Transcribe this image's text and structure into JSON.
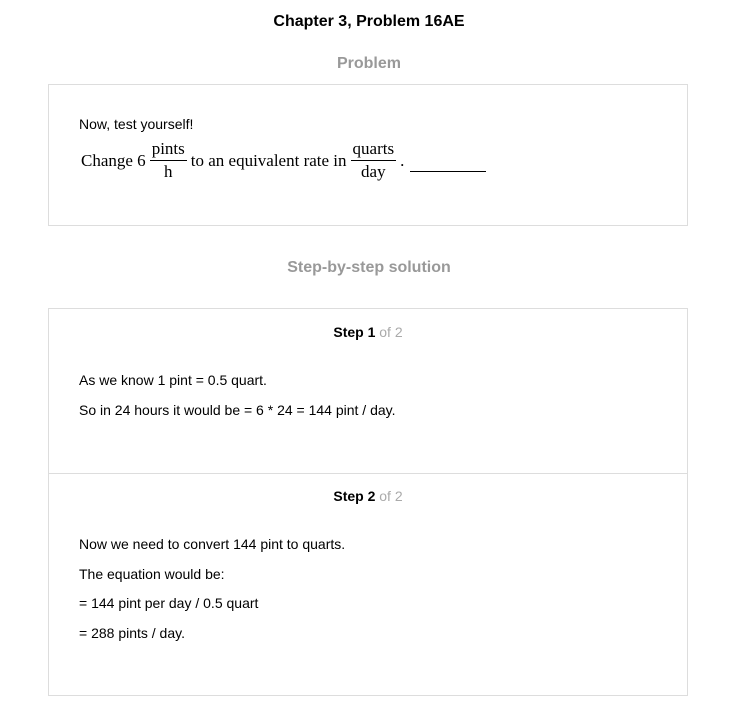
{
  "title": "Chapter 3, Problem 16AE",
  "problem": {
    "heading": "Problem",
    "intro": "Now, test yourself!",
    "equation": {
      "prefix": "Change 6",
      "frac1_num": "pints",
      "frac1_den": "h",
      "middle": "to an equivalent rate in",
      "frac2_num": "quarts",
      "frac2_den": "day",
      "suffix": "."
    }
  },
  "solution": {
    "heading": "Step-by-step solution",
    "steps": [
      {
        "word": "Step 1",
        "of": "of 2",
        "lines": [
          "As we know 1 pint = 0.5 quart.",
          "So in 24 hours it would be = 6 * 24 = 144 pint / day."
        ]
      },
      {
        "word": "Step 2",
        "of": "of 2",
        "lines": [
          "Now we need to convert 144 pint to quarts.",
          "The equation would be:",
          "= 144 pint per day / 0.5 quart",
          "= 288 pints / day."
        ]
      }
    ]
  }
}
